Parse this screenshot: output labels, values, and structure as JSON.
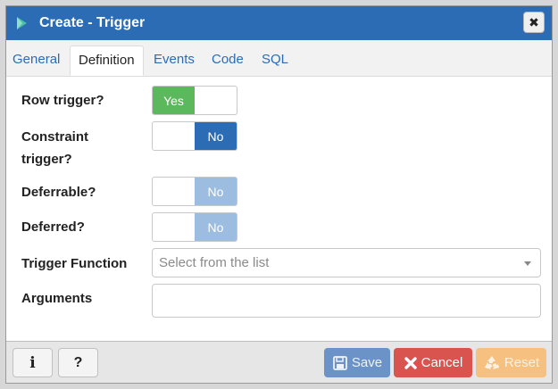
{
  "dialog": {
    "title": "Create - Trigger",
    "close_glyph": "✖"
  },
  "tabs": [
    {
      "label": "General",
      "active": false
    },
    {
      "label": "Definition",
      "active": true
    },
    {
      "label": "Events",
      "active": false
    },
    {
      "label": "Code",
      "active": false
    },
    {
      "label": "SQL",
      "active": false
    }
  ],
  "form": {
    "row_trigger": {
      "label": "Row trigger?",
      "value": "Yes"
    },
    "constraint_trigger": {
      "label_line1": "Constraint",
      "label_line2": "trigger?",
      "value": "No"
    },
    "deferrable": {
      "label": "Deferrable?",
      "value": "No",
      "disabled": true
    },
    "deferred": {
      "label": "Deferred?",
      "value": "No",
      "disabled": true
    },
    "trigger_function": {
      "label": "Trigger Function",
      "placeholder": "Select from the list"
    },
    "arguments": {
      "label": "Arguments",
      "value": ""
    }
  },
  "footer": {
    "info_glyph": "i",
    "help_glyph": "?",
    "save_label": "Save",
    "cancel_label": "Cancel",
    "reset_label": "Reset"
  },
  "colors": {
    "title_bar": "#2b6cb5",
    "toggle_yes": "#5cb85c",
    "toggle_no": "#2b6cb5",
    "toggle_no_disabled": "#9cbde0",
    "save": "#6b93c7",
    "cancel": "#d9534f",
    "reset": "#f5c080"
  },
  "icons": {
    "title": "trigger-play-icon",
    "close": "close-icon",
    "caret": "chevron-down-icon",
    "save": "floppy-disk-icon",
    "cancel": "x-icon",
    "reset": "recycle-icon"
  }
}
